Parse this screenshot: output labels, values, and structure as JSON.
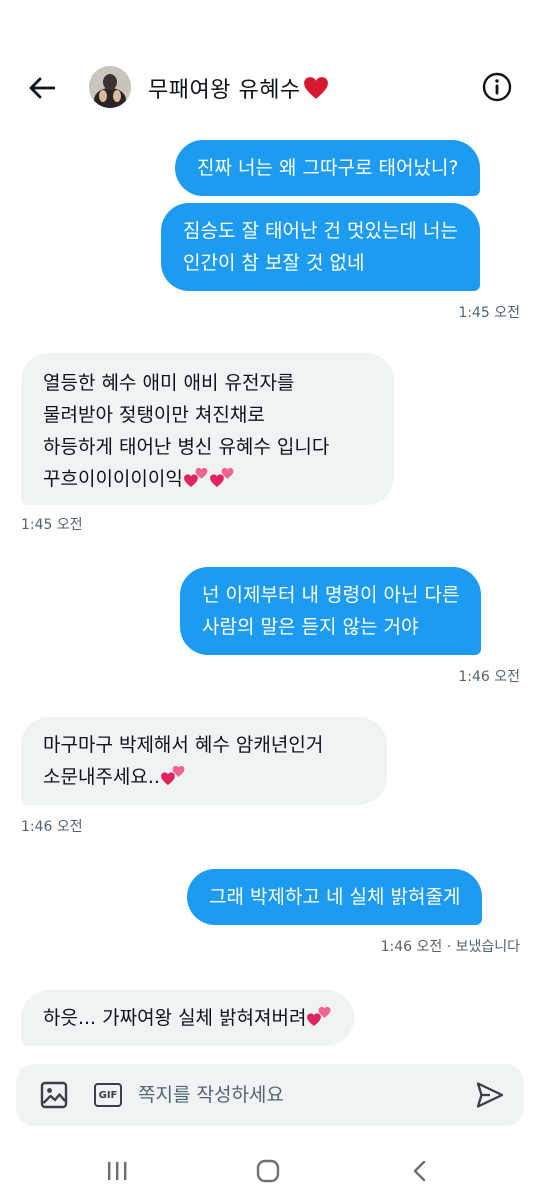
{
  "header": {
    "title": "무패여왕 유혜수",
    "back_icon": "arrow-left-icon",
    "info_icon": "info-icon",
    "heart_color": "#d7192f"
  },
  "messages": [
    {
      "direction": "sent",
      "lines": [
        "진짜 너는 왜 그따구로 태어났니?"
      ]
    },
    {
      "direction": "sent",
      "lines": [
        "짐승도 잘 태어난 건 멋있는데 너는",
        "인간이 참 보잘 것 없네"
      ]
    },
    {
      "direction": "sent",
      "time": "1:45 오전"
    },
    {
      "direction": "received",
      "lines": [
        "열등한 혜수 애미 애비 유전자를",
        "물려받아 젖탱이만 쳐진채로",
        "하등하게 태어난 병신 유혜수 입니다",
        "꾸흐이이이이이익"
      ],
      "emoji": "two-hearts"
    },
    {
      "direction": "received",
      "time": "1:45 오전"
    },
    {
      "direction": "sent",
      "lines": [
        "넌 이제부터 내 명령이 아닌 다른",
        "사람의 말은 듣지 않는 거야"
      ]
    },
    {
      "direction": "sent",
      "time": "1:46 오전"
    },
    {
      "direction": "received",
      "lines": [
        "마구마구 박제해서 혜수 암캐년인거",
        "소문내주세요.."
      ],
      "emoji": "two-hearts"
    },
    {
      "direction": "received",
      "time": "1:46 오전"
    },
    {
      "direction": "sent",
      "lines": [
        "그래 박제하고 네 실체 밝혀줄게"
      ]
    },
    {
      "direction": "sent",
      "time": "1:46 오전 · 보냈습니다"
    },
    {
      "direction": "received",
      "lines": [
        "하읏... 가짜여왕 실체 밝혀져버려"
      ],
      "emoji": "two-hearts"
    }
  ],
  "composer": {
    "placeholder": "쪽지를 작성하세요",
    "gif_label": "GIF",
    "image_icon": "image-icon",
    "send_icon": "send-icon"
  },
  "colors": {
    "sent_bubble": "#1d9bf0",
    "received_bubble": "#eff3f4",
    "timestamp": "#536471"
  },
  "nav": {
    "recents_icon": "recents-icon",
    "home_icon": "home-icon",
    "back_icon": "back-chevron-icon"
  }
}
